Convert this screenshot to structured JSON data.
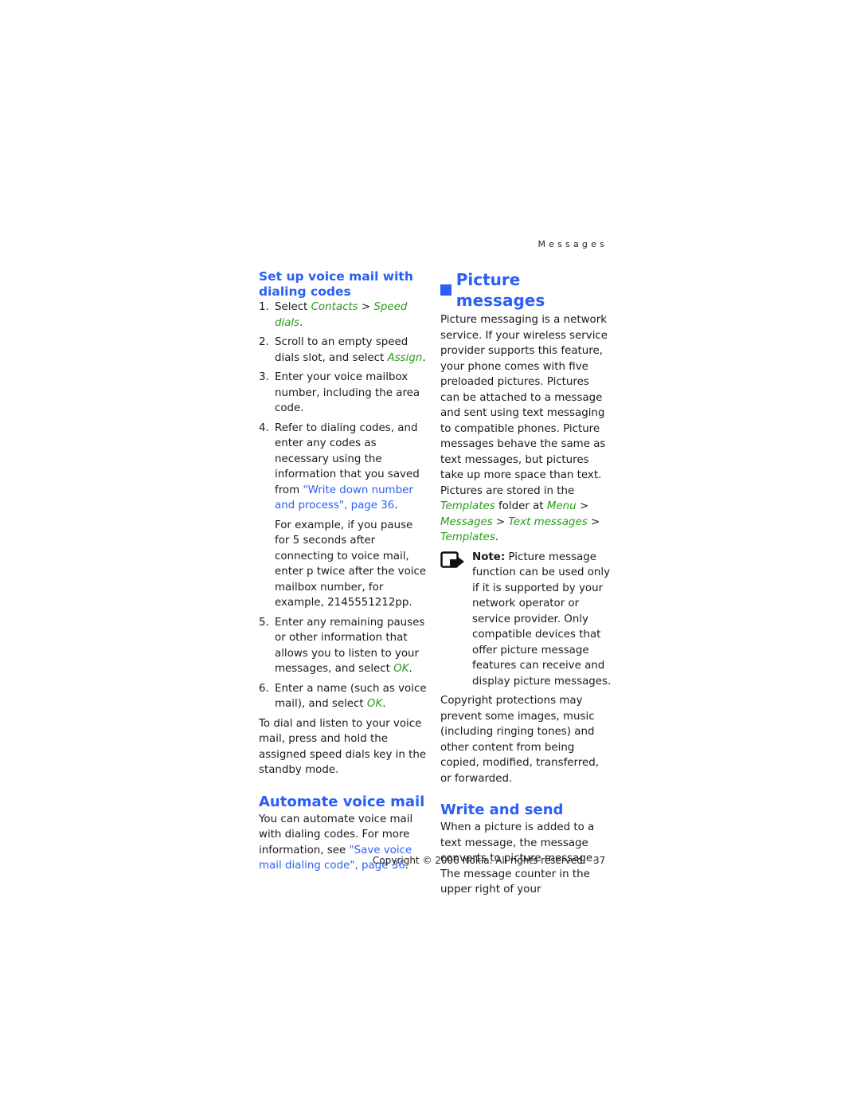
{
  "running_head": "Messages",
  "left": {
    "heading": "Set up voice mail with dialing codes",
    "steps": [
      {
        "num": "1.",
        "pre": "Select ",
        "g1": "Contacts",
        "mid": " > ",
        "g2": "Speed dials",
        "post": "."
      },
      {
        "num": "2.",
        "pre": "Scroll to an empty speed dials slot, and select ",
        "g1": "Assign",
        "post": "."
      },
      {
        "num": "3.",
        "text": "Enter your voice mailbox number, including the area code."
      },
      {
        "num": "4.",
        "pre": "Refer to dialing codes, and enter any codes as necessary using the information that you saved from ",
        "link": "\"Write down number and process\", page 36",
        "post": "."
      },
      {
        "num": "5.",
        "pre": "Enter any remaining pauses or other information that allows you to listen to your messages, and select ",
        "g1": "OK",
        "post": "."
      },
      {
        "num": "6.",
        "pre": "Enter a name (such as voice mail), and select ",
        "g1": "OK",
        "post": "."
      }
    ],
    "example": "For example, if you pause for 5 seconds after connecting to voice mail, enter p twice after the voice mailbox number, for example, 2145551212pp.",
    "dial_text": "To dial and listen to your voice mail, press and hold the assigned speed dials key in the standby mode.",
    "automate_heading": "Automate voice mail",
    "automate_pre": "You can automate voice mail with dialing codes. For more information, see ",
    "automate_link": "\"Save voice mail dialing code\", page 36",
    "automate_post": "."
  },
  "right": {
    "heading": "Picture messages",
    "intro": "Picture messaging is a network service. If your wireless service provider supports this feature, your phone comes with five preloaded pictures. Pictures can be attached to a message and sent using text messaging to compatible phones. Picture messages behave the same as text messages, but pictures take up more space than text. Pictures are stored in the ",
    "templates": "Templates",
    "folder_at": " folder at ",
    "path": [
      "Menu",
      "Messages",
      "Text messages",
      "Templates"
    ],
    "sep": " > ",
    "end": ".",
    "note_label": "Note:",
    "note_text": " Picture message function can be used only if it is supported by your network operator or service provider. Only compatible devices that offer picture message features can receive and display picture messages.",
    "copyright_text": "Copyright protections may prevent some images, music (including ringing tones) and other content from being copied, modified, transferred, or forwarded.",
    "write_heading": "Write and send",
    "write_text": "When a picture is added to a text message, the message converts to picture message. The message counter in the upper right of your"
  },
  "footer": {
    "copyright": "Copyright © 2006 Nokia. All rights reserved.",
    "page": "37"
  }
}
